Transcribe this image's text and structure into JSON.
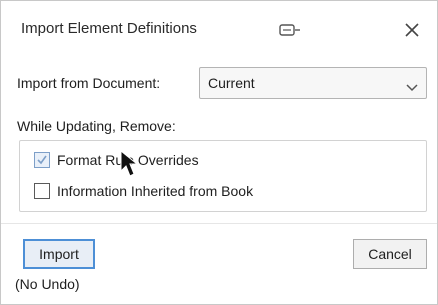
{
  "dialog": {
    "title": "Import Element Definitions",
    "title_icon": "keyboard-shortcut-icon",
    "close_glyph": "✕"
  },
  "import_from": {
    "label": "Import from Document:",
    "selected": "Current"
  },
  "remove_section": {
    "label": "While Updating, Remove:",
    "options": [
      {
        "label": "Format Rule Overrides",
        "checked": true
      },
      {
        "label": "Information Inherited from Book",
        "checked": false
      }
    ]
  },
  "buttons": {
    "import_label": "Import",
    "cancel_label": "Cancel"
  },
  "footer": {
    "note": "(No Undo)"
  },
  "colors": {
    "focus_border": "#4d8fd6",
    "checked_fill": "#e9f0f9"
  }
}
